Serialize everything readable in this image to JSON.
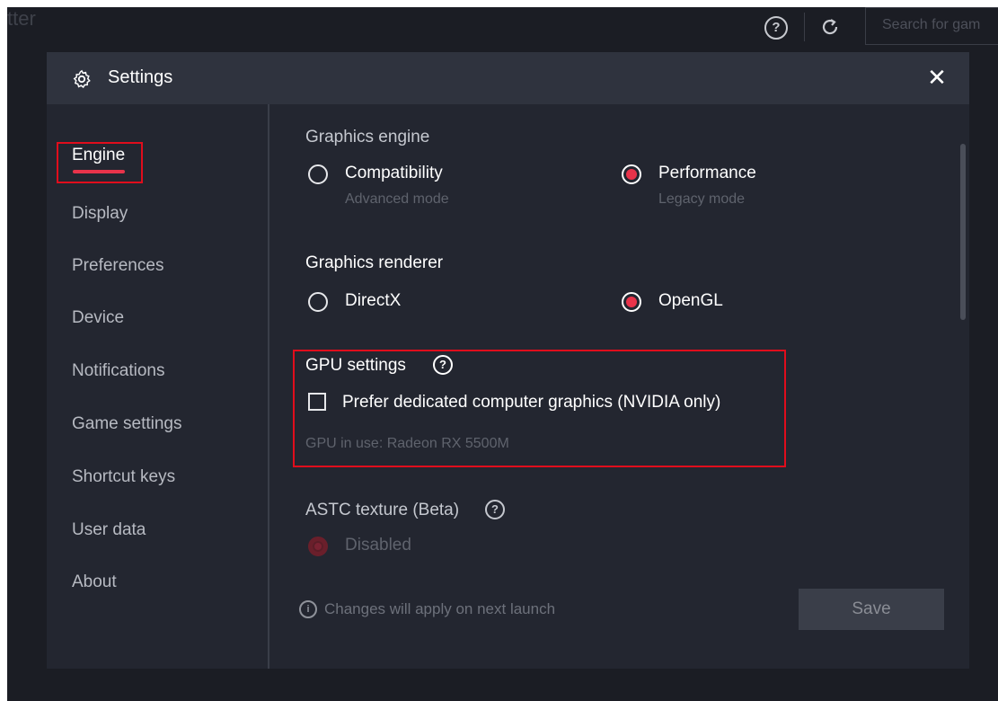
{
  "background_app": {
    "title_fragment": "tter",
    "search_placeholder": "Search for gam",
    "help_icon": "help-circle-icon",
    "refresh_icon": "refresh-icon"
  },
  "dialog": {
    "title": "Settings",
    "close_label": "✕",
    "gear_icon": "gear-icon"
  },
  "sidebar": {
    "items": [
      {
        "label": "Engine",
        "active": true
      },
      {
        "label": "Display"
      },
      {
        "label": "Preferences"
      },
      {
        "label": "Device"
      },
      {
        "label": "Notifications"
      },
      {
        "label": "Game settings"
      },
      {
        "label": "Shortcut keys"
      },
      {
        "label": "User data"
      },
      {
        "label": "About"
      }
    ]
  },
  "engine": {
    "graphics_engine": {
      "label": "Graphics engine",
      "options": [
        {
          "label": "Compatibility",
          "sub": "Advanced mode",
          "selected": false
        },
        {
          "label": "Performance",
          "sub": "Legacy mode",
          "selected": true
        }
      ]
    },
    "graphics_renderer": {
      "label": "Graphics renderer",
      "options": [
        {
          "label": "DirectX",
          "selected": false
        },
        {
          "label": "OpenGL",
          "selected": true
        }
      ]
    },
    "gpu_settings": {
      "label": "GPU settings",
      "help": "?",
      "checkbox_label": "Prefer dedicated computer graphics (NVIDIA only)",
      "checked": false,
      "gpu_in_use": "GPU in use: Radeon RX 5500M"
    },
    "astc": {
      "label": "ASTC texture (Beta)",
      "help": "?",
      "option_label": "Disabled"
    },
    "footer": {
      "info_icon": "i",
      "note": "Changes will apply on next launch",
      "save_label": "Save"
    }
  },
  "colors": {
    "accent": "#e8334a",
    "highlight_box": "#e00d1c",
    "dialog_bg": "#232630",
    "header_bg": "#2f333e"
  }
}
